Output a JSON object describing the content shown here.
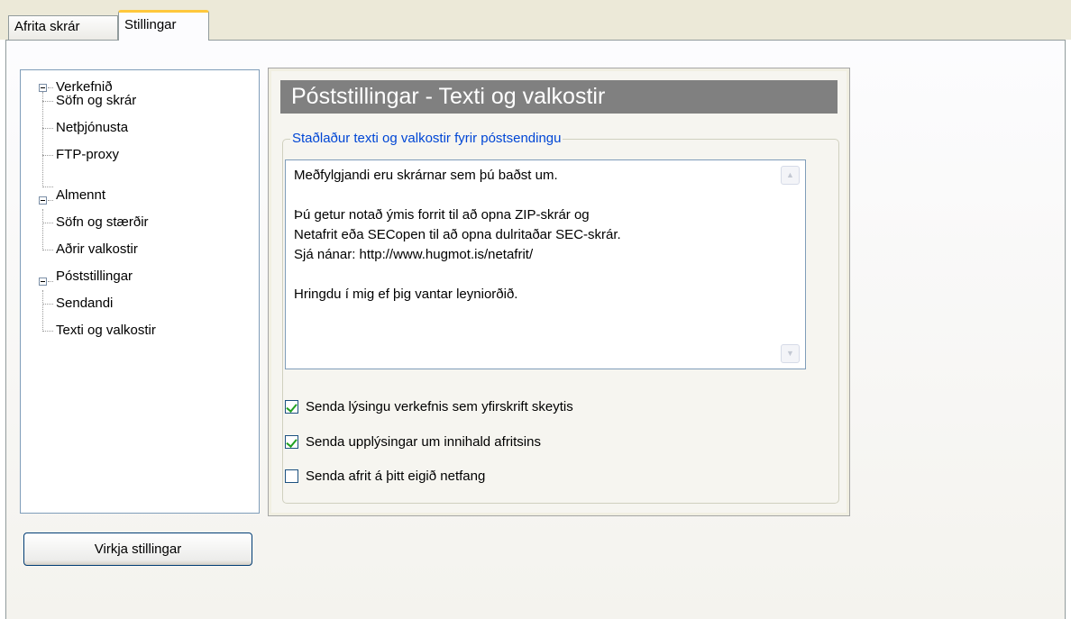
{
  "tabs": [
    {
      "label": "Afrita skrár",
      "active": false
    },
    {
      "label": "Stillingar",
      "active": true
    }
  ],
  "tree": {
    "groups": [
      {
        "label": "Verkefnið",
        "children": [
          "Söfn og skrár",
          "Netþjónusta",
          "FTP-proxy"
        ]
      },
      {
        "label": "Almennt",
        "children": [
          "Söfn og stærðir",
          "Aðrir valkostir"
        ]
      },
      {
        "label": "Póststillingar",
        "children": [
          "Sendandi",
          "Texti og valkostir"
        ]
      }
    ]
  },
  "panel": {
    "title": "Póststillingar - Texti og valkostir",
    "group_label": "Staðlaður texti og valkostir fyrir póstsendingu",
    "message_text": "Meðfylgjandi eru skrárnar sem þú baðst um.\n\nÞú getur notað ýmis forrit til að opna ZIP-skrár og\nNetafrit eða SECopen til að opna dulritaðar SEC-skrár.\nSjá nánar: http://www.hugmot.is/netafrit/\n\nHringdu í mig ef þig vantar leyniorðið.",
    "options": [
      {
        "label": "Senda lýsingu verkefnis sem yfirskrift skeytis",
        "checked": true
      },
      {
        "label": "Senda upplýsingar um innihald afritsins",
        "checked": true
      },
      {
        "label": "Senda afrit á þitt eigið netfang",
        "checked": false
      }
    ]
  },
  "apply_button_label": "Virkja stillingar",
  "colors": {
    "banner_bg": "#808080",
    "legend_text": "#0046d5",
    "active_tab_accent": "#ffc83c",
    "check_mark": "#21a121"
  }
}
